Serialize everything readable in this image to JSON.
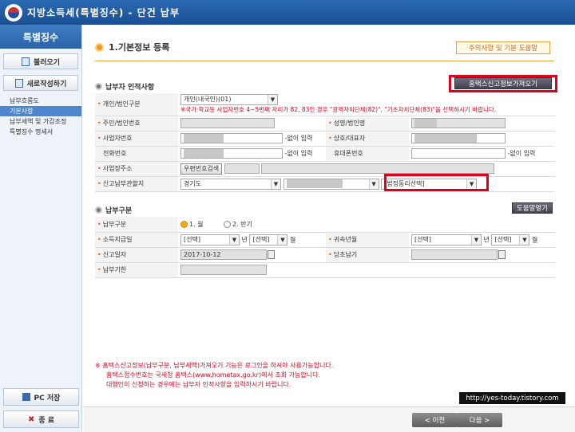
{
  "window": {
    "title": "지방소득세(특별징수) - 단건 납부"
  },
  "sidebar": {
    "header": "특별징수",
    "load_button": "불러오기",
    "new_button": "새로작성하기",
    "items": [
      "납부흐름도",
      "기본사항",
      "납부세액 및 가감조정",
      "특별징수 명세서"
    ],
    "pc_save": "PC 저장",
    "exit": "종 료"
  },
  "main": {
    "section_title": "1.기본정보 등록",
    "help_top": "주의사항 및 기본 도움말",
    "taxpayer_title": "납부자 인적사항",
    "hometax_button": "홈택스신고정보가져오기",
    "rows": {
      "type_label": "개인/법인구분",
      "type_value": "개인(내국인)(01)",
      "type_note": "※국가·학교등 사업자번호 4~5번째 자리가 82, 83인 경우 \"광역자치단체(82)\", \"기초자치단체(83)\"을 선택하시기 바랍니다.",
      "rrn_label": "주민/법인번호",
      "name_label": "성명/법인명",
      "bizno_label": "사업자번호",
      "bizno_suffix": "-없이 입력",
      "company_label": "상호/대표자",
      "phone_label": "전화번호",
      "phone_suffix": "-없이 입력",
      "mobile_label": "휴대폰번호",
      "mobile_suffix": "-없이 입력",
      "address_label": "사업장주소",
      "zip_button": "우편번호검색",
      "place_label": "신고납부관할지",
      "place_value": "경기도",
      "dong_value": "[법정동리선택]"
    },
    "payment_title": "납부구분",
    "help_open": "도움말열기",
    "payment": {
      "kind_label": "납부구분",
      "kind_options": [
        "1. 월",
        "2. 반기"
      ],
      "income_label": "소득지급일",
      "select_placeholder": "[선택]",
      "year_unit": "년",
      "month_unit": "월",
      "belong_label": "귀속년월",
      "report_label": "신고일자",
      "report_date": "2017-10-12",
      "due_label": "당초납기",
      "deadline_label": "납부기한"
    },
    "notes": [
      "※  홈택스신고정보(납부구분, 납부세액)가져오기 기능은 로그인을 하셔야 사용가능합니다.",
      "홈택스접수번호는 국세청 홈택스(www.hometax.go.kr)에서 조회 가능합니다.",
      "대행인이 신청하는 경우에는 납부자 인적사항을 입력하시기 바랍니다."
    ],
    "url": "http://yes-today.tistory.com",
    "prev_button": "< 이전",
    "next_button": "다음 >"
  }
}
